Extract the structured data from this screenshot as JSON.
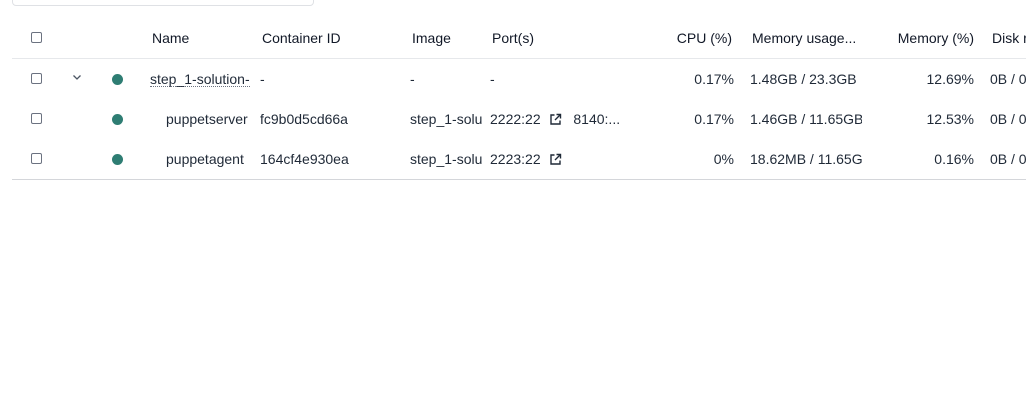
{
  "header": {
    "name": "Name",
    "container_id": "Container ID",
    "image": "Image",
    "ports": "Port(s)",
    "cpu": "CPU (%)",
    "memory_usage": "Memory usage...",
    "memory_pct": "Memory (%)",
    "disk": "Disk r"
  },
  "rows": [
    {
      "name": "step_1-solution-",
      "container_id": "-",
      "image": "-",
      "port1": "-",
      "port2": "",
      "cpu": "0.17%",
      "memory_usage": "1.48GB / 23.3GB",
      "memory_pct": "12.69%",
      "disk": "0B / 0",
      "status_color": "#2e7d73"
    },
    {
      "name": "puppetserver",
      "container_id": "fc9b0d5cd66a",
      "image": "step_1-solu",
      "port1": "2222:22",
      "port2": "8140:...",
      "cpu": "0.17%",
      "memory_usage": "1.46GB / 11.65GB",
      "memory_pct": "12.53%",
      "disk": "0B / 0",
      "status_color": "#2e7d73"
    },
    {
      "name": "puppetagent",
      "container_id": "164cf4e930ea",
      "image": "step_1-solu",
      "port1": "2223:22",
      "port2": "",
      "cpu": "0%",
      "memory_usage": "18.62MB / 11.65G",
      "memory_pct": "0.16%",
      "disk": "0B / 0",
      "status_color": "#2e7d73"
    }
  ],
  "icons": {
    "checkbox": "checkbox-icon",
    "expand": "chevron-down-icon",
    "status": "status-dot-icon",
    "external_link": "external-link-icon"
  }
}
